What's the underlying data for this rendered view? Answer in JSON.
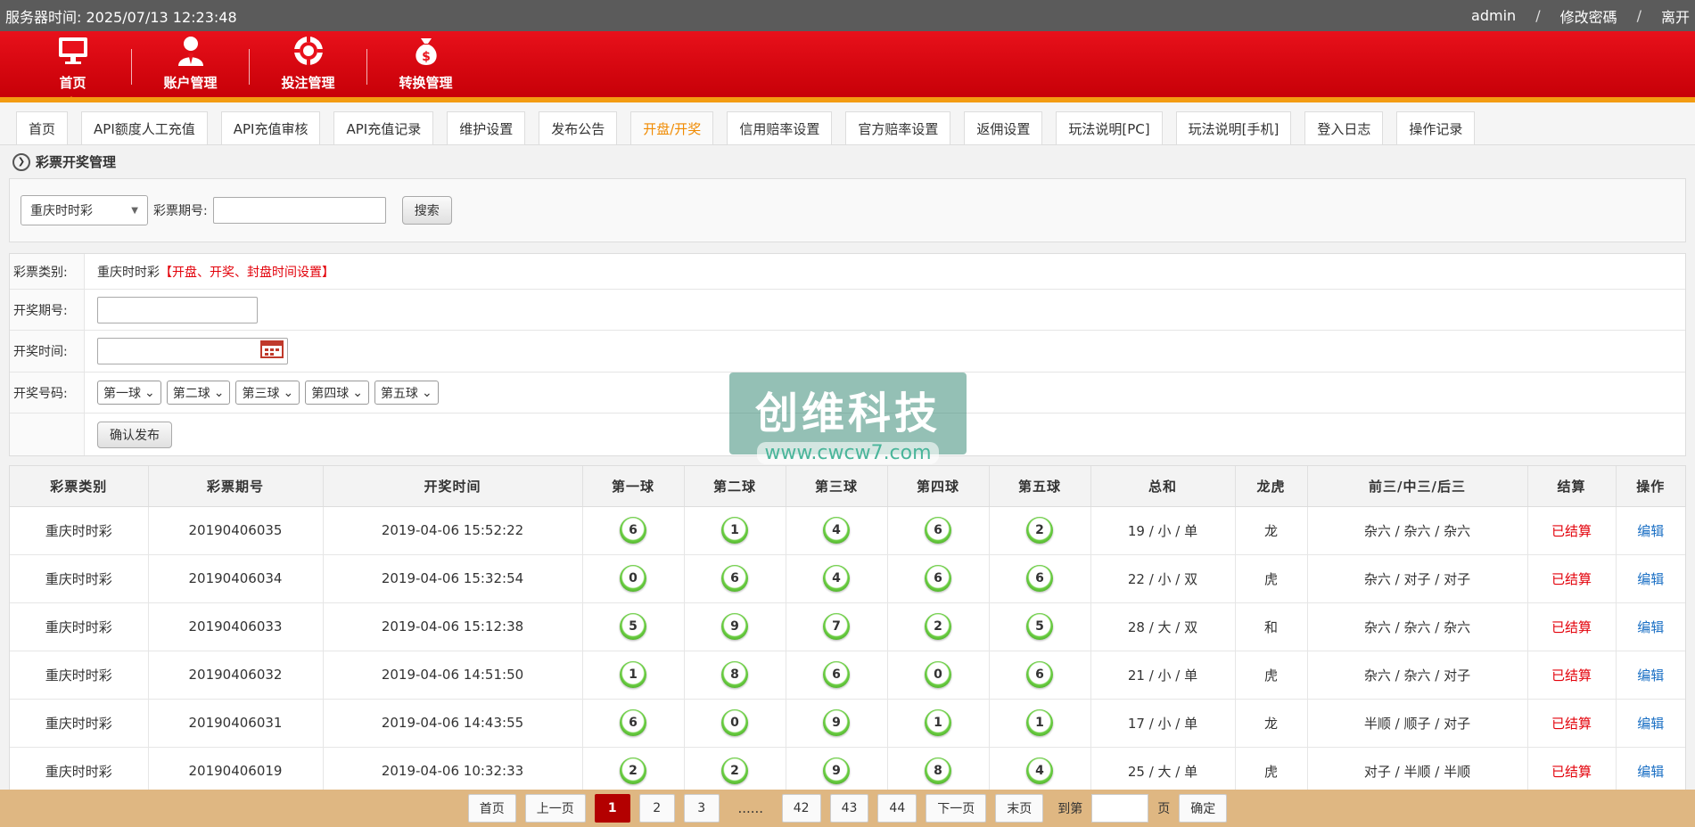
{
  "topbar": {
    "server_time": "服务器时间: 2025/07/13 12:23:48",
    "user": "admin",
    "change_password": "修改密碼",
    "logout": "离开"
  },
  "nav": [
    {
      "label": "首页",
      "icon": "monitor-icon"
    },
    {
      "label": "账户管理",
      "icon": "user-icon"
    },
    {
      "label": "投注管理",
      "icon": "chip-icon"
    },
    {
      "label": "转换管理",
      "icon": "money-bag-icon"
    }
  ],
  "tabs": [
    "首页",
    "API额度人工充值",
    "API充值审核",
    "API充值记录",
    "维护设置",
    "发布公告",
    "开盘/开奖",
    "信用赔率设置",
    "官方赔率设置",
    "返佣设置",
    "玩法说明[PC]",
    "玩法说明[手机]",
    "登入日志",
    "操作记录"
  ],
  "active_tab": 6,
  "section_title": "彩票开奖管理",
  "search": {
    "lottery_select": "重庆时时彩",
    "issue_label": "彩票期号:",
    "search_button": "搜索"
  },
  "form": {
    "type_label": "彩票类别:",
    "type_value": "重庆时时彩",
    "type_link": "【开盘、开奖、封盘时间设置】",
    "issue_label": "开奖期号:",
    "time_label": "开奖时间:",
    "code_label": "开奖号码:",
    "balls": [
      "第一球",
      "第二球",
      "第三球",
      "第四球",
      "第五球"
    ],
    "submit": "确认发布"
  },
  "table": {
    "headers": [
      "彩票类别",
      "彩票期号",
      "开奖时间",
      "第一球",
      "第二球",
      "第三球",
      "第四球",
      "第五球",
      "总和",
      "龙虎",
      "前三/中三/后三",
      "结算",
      "操作"
    ],
    "rows": [
      {
        "type": "重庆时时彩",
        "issue": "20190406035",
        "time": "2019-04-06 15:52:22",
        "b1": "6",
        "b2": "1",
        "b3": "4",
        "b4": "6",
        "b5": "2",
        "sum": "19 / 小 / 单",
        "dt": "龙",
        "pos": "杂六 / 杂六 / 杂六",
        "status": "已结算",
        "op": "编辑"
      },
      {
        "type": "重庆时时彩",
        "issue": "20190406034",
        "time": "2019-04-06 15:32:54",
        "b1": "0",
        "b2": "6",
        "b3": "4",
        "b4": "6",
        "b5": "6",
        "sum": "22 / 小 / 双",
        "dt": "虎",
        "pos": "杂六 / 对子 / 对子",
        "status": "已结算",
        "op": "编辑"
      },
      {
        "type": "重庆时时彩",
        "issue": "20190406033",
        "time": "2019-04-06 15:12:38",
        "b1": "5",
        "b2": "9",
        "b3": "7",
        "b4": "2",
        "b5": "5",
        "sum": "28 / 大 / 双",
        "dt": "和",
        "pos": "杂六 / 杂六 / 杂六",
        "status": "已结算",
        "op": "编辑"
      },
      {
        "type": "重庆时时彩",
        "issue": "20190406032",
        "time": "2019-04-06 14:51:50",
        "b1": "1",
        "b2": "8",
        "b3": "6",
        "b4": "0",
        "b5": "6",
        "sum": "21 / 小 / 单",
        "dt": "虎",
        "pos": "杂六 / 杂六 / 对子",
        "status": "已结算",
        "op": "编辑"
      },
      {
        "type": "重庆时时彩",
        "issue": "20190406031",
        "time": "2019-04-06 14:43:55",
        "b1": "6",
        "b2": "0",
        "b3": "9",
        "b4": "1",
        "b5": "1",
        "sum": "17 / 小 / 单",
        "dt": "龙",
        "pos": "半顺 / 顺子 / 对子",
        "status": "已结算",
        "op": "编辑"
      },
      {
        "type": "重庆时时彩",
        "issue": "20190406019",
        "time": "2019-04-06 10:32:33",
        "b1": "2",
        "b2": "2",
        "b3": "9",
        "b4": "8",
        "b5": "4",
        "sum": "25 / 大 / 单",
        "dt": "虎",
        "pos": "对子 / 半顺 / 半顺",
        "status": "已结算",
        "op": "编辑"
      }
    ]
  },
  "pager": {
    "first": "首页",
    "prev": "上一页",
    "pages": [
      "1",
      "2",
      "3"
    ],
    "dots": "......",
    "tail_pages": [
      "42",
      "43",
      "44"
    ],
    "next": "下一页",
    "last": "末页",
    "goto_label": "到第",
    "page_unit": "页",
    "confirm": "确定",
    "current": "1"
  },
  "watermark": {
    "title": "创维科技",
    "url": "www.cwcw7.com"
  },
  "colors": {
    "header_red": "#d4060f",
    "accent_orange": "#f08a00",
    "status_red": "#e3020b",
    "link_blue": "#1a6fc4",
    "ball_green": "#2f8c14",
    "pager_bg": "#dfb782"
  }
}
